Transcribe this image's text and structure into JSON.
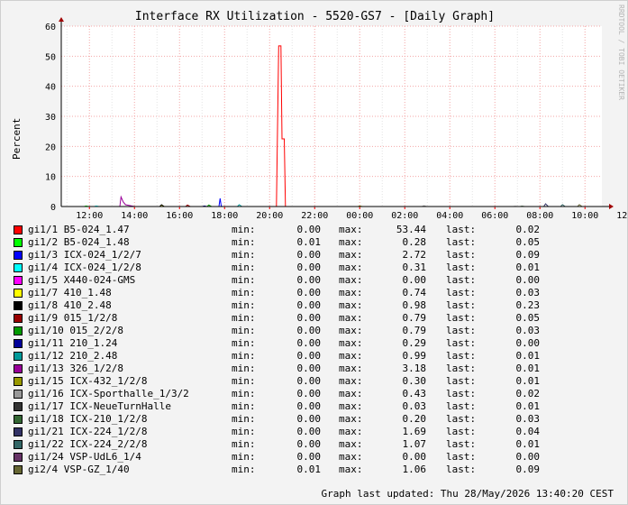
{
  "chart_data": {
    "type": "line",
    "title": "Interface RX Utilization - 5520-GS7 - [Daily Graph]",
    "ylabel": "Percent",
    "ylim": [
      0,
      60
    ],
    "yticks": [
      0,
      10,
      20,
      30,
      40,
      50,
      60
    ],
    "xticks": [
      "12:00",
      "14:00",
      "16:00",
      "18:00",
      "20:00",
      "22:00",
      "00:00",
      "02:00",
      "04:00",
      "06:00",
      "08:00",
      "10:00",
      "12:00"
    ],
    "grid": true,
    "watermark": "RRDTOOL / TOBI OETIKER",
    "series": [
      {
        "name": "gi1/1 B5-024_1.47",
        "color": "#ff0000",
        "min": "0.00",
        "max": "53.44",
        "last": "0.02",
        "points": [
          [
            20.3,
            0
          ],
          [
            20.4,
            53.44
          ],
          [
            20.5,
            53.44
          ],
          [
            20.55,
            22.5
          ],
          [
            20.65,
            22.5
          ],
          [
            20.7,
            0.1
          ]
        ]
      },
      {
        "name": "gi1/2 B5-024_1.48",
        "color": "#00ff00",
        "min": "0.01",
        "max": "0.28",
        "last": "0.05",
        "points": []
      },
      {
        "name": "gi1/3 ICX-024_1/2/7",
        "color": "#0000ff",
        "min": "0.00",
        "max": "2.72",
        "last": "0.09",
        "points": [
          [
            17.75,
            0
          ],
          [
            17.8,
            2.72
          ],
          [
            17.85,
            0.2
          ],
          [
            17.9,
            0
          ]
        ]
      },
      {
        "name": "gi1/4 ICX-024_1/2/8",
        "color": "#00ffff",
        "min": "0.00",
        "max": "0.31",
        "last": "0.01",
        "points": []
      },
      {
        "name": "gi1/5 X440-024-GMS",
        "color": "#ff00ff",
        "min": "0.00",
        "max": "0.00",
        "last": "0.00",
        "points": []
      },
      {
        "name": "gi1/7 410_1.48",
        "color": "#ffff00",
        "min": "0.00",
        "max": "0.74",
        "last": "0.03",
        "points": []
      },
      {
        "name": "gi1/8 410_2.48",
        "color": "#000000",
        "min": "0.00",
        "max": "0.98",
        "last": "0.23",
        "points": []
      },
      {
        "name": "gi1/9 015_1/2/8",
        "color": "#990000",
        "min": "0.00",
        "max": "0.79",
        "last": "0.05",
        "points": []
      },
      {
        "name": "gi1/10 015_2/2/8",
        "color": "#009900",
        "min": "0.00",
        "max": "0.79",
        "last": "0.03",
        "points": []
      },
      {
        "name": "gi1/11 210_1.24",
        "color": "#000099",
        "min": "0.00",
        "max": "0.29",
        "last": "0.00",
        "points": []
      },
      {
        "name": "gi1/12 210_2.48",
        "color": "#009999",
        "min": "0.00",
        "max": "0.99",
        "last": "0.01",
        "points": []
      },
      {
        "name": "gi1/13 326_1/2/8",
        "color": "#990099",
        "min": "0.00",
        "max": "3.18",
        "last": "0.01",
        "points": [
          [
            13.35,
            0
          ],
          [
            13.4,
            3.18
          ],
          [
            13.5,
            1.5
          ],
          [
            13.6,
            0.6
          ],
          [
            13.8,
            0.3
          ],
          [
            14.0,
            0
          ]
        ]
      },
      {
        "name": "gi1/15 ICX-432_1/2/8",
        "color": "#999900",
        "min": "0.00",
        "max": "0.30",
        "last": "0.01",
        "points": []
      },
      {
        "name": "gi1/16 ICX-Sporthalle_1/3/2",
        "color": "#999999",
        "min": "0.00",
        "max": "0.43",
        "last": "0.02",
        "points": []
      },
      {
        "name": "gi1/17 ICX-NeueTurnHalle",
        "color": "#333333",
        "min": "0.00",
        "max": "0.03",
        "last": "0.01",
        "points": []
      },
      {
        "name": "gi1/18 ICX-210_1/2/8",
        "color": "#336633",
        "min": "0.00",
        "max": "0.20",
        "last": "0.03",
        "points": []
      },
      {
        "name": "gi1/21 ICX-224_1/2/8",
        "color": "#333366",
        "min": "0.00",
        "max": "1.69",
        "last": "0.04",
        "points": []
      },
      {
        "name": "gi1/22 ICX-224_2/2/8",
        "color": "#336666",
        "min": "0.00",
        "max": "1.07",
        "last": "0.01",
        "points": []
      },
      {
        "name": "gi1/24 VSP-UdL6_1/4",
        "color": "#663366",
        "min": "0.00",
        "max": "0.00",
        "last": "0.00",
        "points": []
      },
      {
        "name": "gi2/4 VSP-GZ_1/40",
        "color": "#666633",
        "min": "0.01",
        "max": "1.06",
        "last": "0.09",
        "points": []
      }
    ]
  },
  "legend_labels": {
    "min": "min:",
    "max": "max:",
    "last": "last:"
  },
  "footer": "Graph last updated: Thu 28/May/2026 13:40:20 CEST"
}
